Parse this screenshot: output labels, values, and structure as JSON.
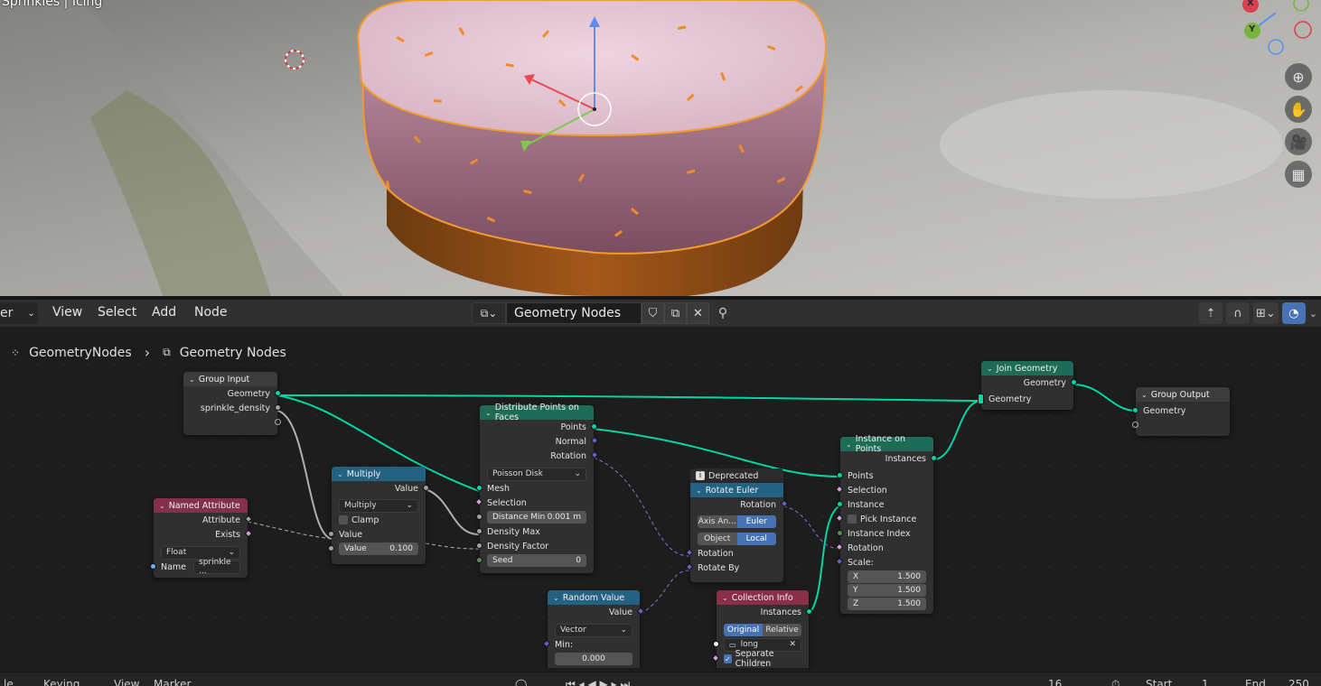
{
  "viewport": {
    "title": "Sprinkles | Icing",
    "tools": [
      {
        "icon": "zoom-icon",
        "glyph": "⊕"
      },
      {
        "icon": "hand-icon",
        "glyph": "✋"
      },
      {
        "icon": "camera-icon",
        "glyph": "🎥"
      },
      {
        "icon": "grid-icon",
        "glyph": "▦"
      }
    ],
    "gizmo": {
      "x": "X",
      "y": "Y"
    }
  },
  "header": {
    "editor_fragment": "er",
    "menus": [
      "View",
      "Select",
      "Add",
      "Node"
    ],
    "node_tree_name": "Geometry Nodes"
  },
  "breadcrumb": {
    "object": "GeometryNodes",
    "tree": "Geometry Nodes"
  },
  "nodes": {
    "group_input": {
      "title": "Group Input",
      "geometry": "Geometry",
      "density": "sprinkle_density"
    },
    "join": {
      "title": "Join Geometry",
      "out": "Geometry",
      "in": "Geometry"
    },
    "group_output": {
      "title": "Group Output",
      "in": "Geometry"
    },
    "distribute": {
      "title": "Distribute Points on Faces",
      "points": "Points",
      "normal": "Normal",
      "rotation": "Rotation",
      "mode": "Poisson Disk",
      "mesh": "Mesh",
      "selection": "Selection",
      "distance_label": "Distance Min",
      "distance_value": "0.001 m",
      "density_max": "Density Max",
      "density_factor": "Density Factor",
      "seed_label": "Seed",
      "seed_value": "0"
    },
    "multiply": {
      "title": "Multiply",
      "out": "Value",
      "op": "Multiply",
      "clamp": "Clamp",
      "in1": "Value",
      "in2_label": "Value",
      "in2_value": "0.100"
    },
    "named_attr": {
      "title": "Named Attribute",
      "attribute": "Attribute",
      "exists": "Exists",
      "type": "Float",
      "name_label": "Name",
      "name_value": "sprinkle ..."
    },
    "rotate": {
      "badge": "Deprecated",
      "title": "Rotate Euler",
      "out": "Rotation",
      "seg1a": "Axis An...",
      "seg1b": "Euler",
      "seg2a": "Object",
      "seg2b": "Local",
      "in_rot": "Rotation",
      "in_by": "Rotate By"
    },
    "instance": {
      "title": "Instance on Points",
      "out": "Instances",
      "points": "Points",
      "selection": "Selection",
      "instance": "Instance",
      "pick": "Pick Instance",
      "index": "Instance Index",
      "rotation": "Rotation",
      "scale": "Scale:",
      "x": "X",
      "xv": "1.500",
      "y": "Y",
      "yv": "1.500",
      "z": "Z",
      "zv": "1.500"
    },
    "random": {
      "title": "Random Value",
      "out": "Value",
      "type": "Vector",
      "min": "Min:",
      "min_v": "0.000"
    },
    "collection": {
      "title": "Collection Info",
      "out": "Instances",
      "seg_a": "Original",
      "seg_b": "Relative",
      "coll": "long",
      "sep": "Separate Children"
    }
  },
  "footer": {
    "a": "le",
    "b": "Keying",
    "c": "View",
    "d": "Marker",
    "frame": "16",
    "start_label": "Start",
    "start": "1",
    "end_label": "End",
    "end": "250"
  },
  "colors": {
    "geometry_link": "#00d6a3",
    "float_link": "#a1a1a1",
    "vector_link": "#6363c7",
    "accent": "#4772b3"
  }
}
